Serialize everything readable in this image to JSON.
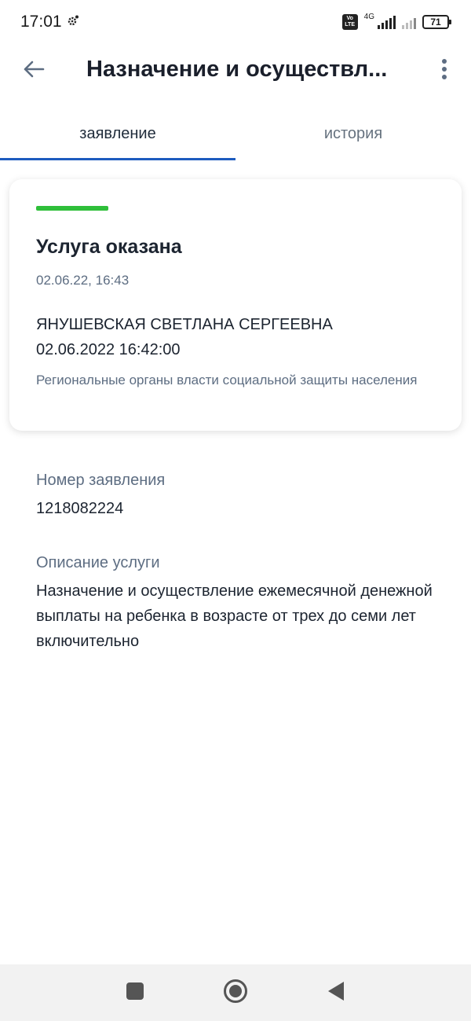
{
  "status_bar": {
    "time": "17:01",
    "network": "4G",
    "volte": "Vo LTE",
    "battery": "71"
  },
  "app_bar": {
    "title": "Назначение и осуществл..."
  },
  "tabs": [
    {
      "label": "заявление",
      "active": true
    },
    {
      "label": "история",
      "active": false
    }
  ],
  "card": {
    "status": "Услуга оказана",
    "status_color": "#2fbf3a",
    "date": "02.06.22, 16:43",
    "person": "ЯНУШЕВСКАЯ СВЕТЛАНА СЕРГЕЕВНА",
    "person_datetime": "02.06.2022 16:42:00",
    "organization": "Региональные органы власти социальной защиты населения"
  },
  "fields": {
    "application_number_label": "Номер заявления",
    "application_number": "1218082224",
    "description_label": "Описание услуги",
    "description": "Назначение и осуществление ежемесячной денежной выплаты на ребенка в возрасте от трех до семи лет включительно"
  },
  "icons": {
    "back": "arrow-left-icon",
    "more": "more-vertical-icon",
    "nav_recents": "square-icon",
    "nav_home": "circle-icon",
    "nav_back": "triangle-back-icon"
  },
  "colors": {
    "accent": "#1d5bbf",
    "success": "#2fbf3a",
    "secondary_text": "#5d6d82"
  }
}
